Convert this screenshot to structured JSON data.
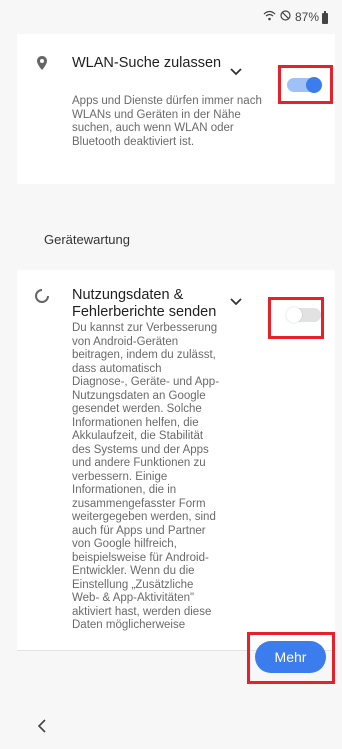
{
  "status_bar": {
    "wifi_icon": "wifi-icon",
    "mute_icon": "do-not-disturb-icon",
    "battery": "87%"
  },
  "wlan_setting": {
    "title": "WLAN-Suche zulassen",
    "description": "Apps und Dienste dürfen immer nach WLANs und Geräten in der Nähe suchen, auch wenn WLAN oder Bluetooth deaktiviert ist.",
    "enabled": true
  },
  "section_header": "Gerätewartung",
  "usage_setting": {
    "title": "Nutzungsdaten & Fehlerberichte senden",
    "description": "Du kannst zur Verbesserung von Android-Geräten beitragen, indem du zulässt, dass automatisch Diagnose-, Geräte- und App-Nutzungsdaten an Google gesendet werden. Solche Informationen helfen, die Akkulaufzeit, die Stabilität des Systems und der Apps und andere Funktionen zu verbessern. Einige Informationen, die in zusammengefasster Form weitergegeben werden, sind auch für Apps und Partner von Google hilfreich, beispielsweise für Android-Entwickler. Wenn du die Einstellung „Zusätzliche Web- & App-Aktivitäten\" aktiviert hast, werden diese Daten möglicherweise",
    "enabled": false
  },
  "footer": {
    "more_label": "Mehr"
  },
  "colors": {
    "accent": "#3b7ded",
    "highlight": "#e8202a"
  }
}
